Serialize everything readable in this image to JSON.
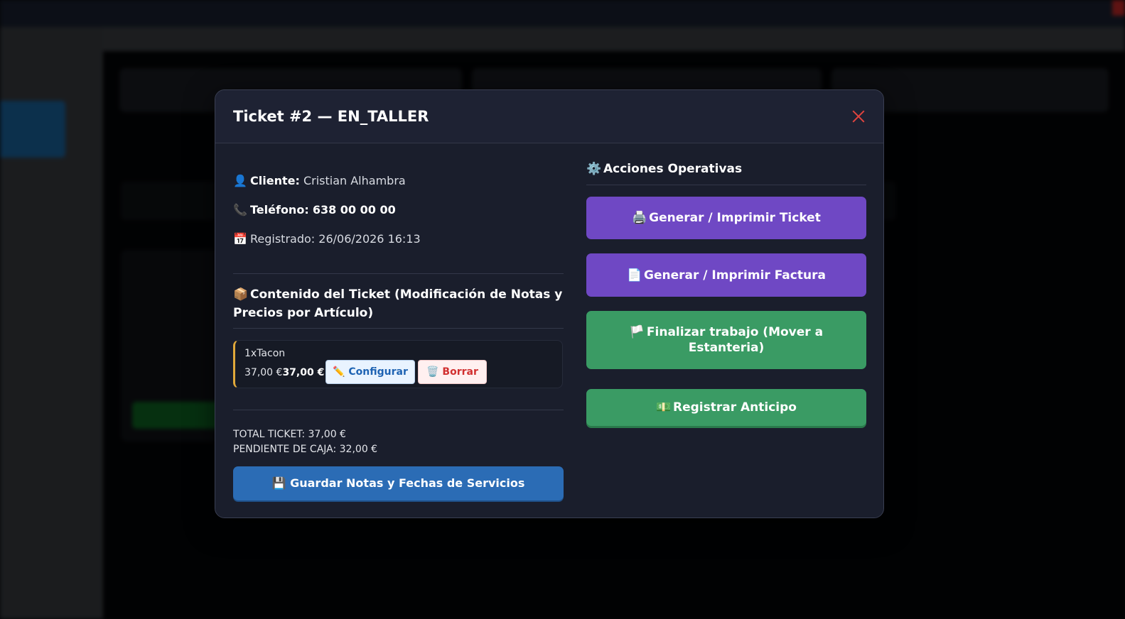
{
  "modal": {
    "title": "Ticket #2 — EN_TALLER",
    "client": {
      "icon": "👤",
      "label": "Cliente:",
      "value": "Cristian Alhambra"
    },
    "phone": {
      "icon": "📞",
      "label": "Teléfono:",
      "value": "638 00 00 00"
    },
    "registered": {
      "icon": "📅",
      "text": "Registrado: 26/06/2026 16:13"
    },
    "contents_title_icon": "📦",
    "contents_title": "Contenido del Ticket (Modificación de Notas y Precios por Artículo)",
    "items": [
      {
        "name": "1xTacon",
        "price": "37,00 €",
        "price_bold": "37,00 €",
        "configure_icon": "✏️",
        "configure_label": "Configurar",
        "delete_icon": "🗑️",
        "delete_label": "Borrar"
      }
    ],
    "total": "TOTAL TICKET: 37,00 €",
    "pending": "PENDIENTE DE CAJA: 32,00 €",
    "save_icon": "💾",
    "save_label": "Guardar Notas y Fechas de Servicios",
    "actions_icon": "⚙️",
    "actions_title": "Acciones Operativas",
    "actions": {
      "print_ticket": {
        "icon": "🖨️",
        "label": "Generar / Imprimir Ticket"
      },
      "print_invoice": {
        "icon": "📄",
        "label": "Generar / Imprimir Factura"
      },
      "finish": {
        "icon": "🏳️",
        "label": "Finalizar trabajo (Mover a Estanteria)"
      },
      "advance": {
        "icon": "💵",
        "label": "Registrar Anticipo"
      }
    }
  },
  "colors": {
    "modal_bg": "#1f2334",
    "purple": "#6f48c4",
    "green": "#3a9b64",
    "blue": "#2b6cb5",
    "accent_border": "#e0a83a",
    "close": "#e0443e"
  }
}
